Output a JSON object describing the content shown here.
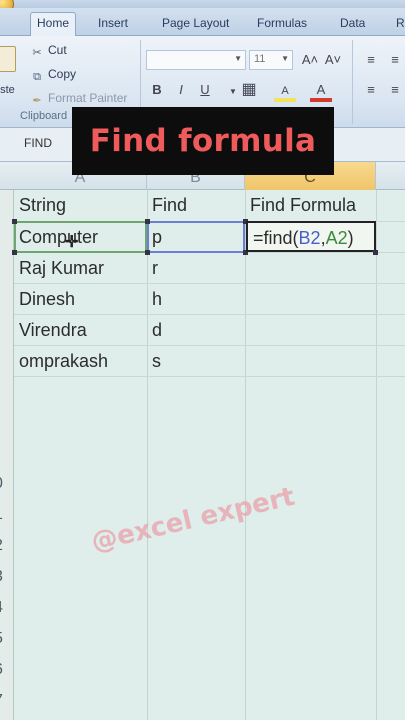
{
  "ribbon": {
    "tabs": [
      "Home",
      "Insert",
      "Page Layout",
      "Formulas",
      "Data",
      "R"
    ],
    "active_tab": "Home",
    "clipboard": {
      "paste_label": "aste",
      "cut_label": "Cut",
      "copy_label": "Copy",
      "format_painter_label": "Format Painter",
      "group_label": "Clipboard"
    },
    "font": {
      "size_value": "11",
      "grow_label": "A˄",
      "shrink_label": "A˅",
      "bold_label": "B",
      "italic_label": "I",
      "underline_label": "U",
      "fill_label": "A",
      "font_color_label": "A"
    }
  },
  "formula_bar": {
    "name_box": "FIND"
  },
  "grid": {
    "columns": [
      "A",
      "B",
      "C"
    ],
    "rows": [
      "0",
      "1",
      "2",
      "3",
      "4",
      "5",
      "6",
      "7"
    ],
    "header_row": {
      "a": "String",
      "b": "Find",
      "c": "Find Formula"
    },
    "data_rows": [
      {
        "a": "Computer",
        "b": "p"
      },
      {
        "a": "Raj Kumar",
        "b": "r"
      },
      {
        "a": "Dinesh",
        "b": "h"
      },
      {
        "a": "Virendra",
        "b": "d"
      },
      {
        "a": "omprakash",
        "b": "s"
      }
    ],
    "formula_cell": {
      "prefix": "=find(",
      "ref1": "B2",
      "comma": ",",
      "ref2": "A2",
      "suffix": ")"
    }
  },
  "overlay": {
    "banner": "Find formula",
    "watermark": "@excel expert"
  },
  "colors": {
    "banner_bg": "#0d0d0d",
    "banner_text": "#ef5b5b",
    "ref_b2": "#4a5fc6",
    "ref_a2": "#3a8a3a",
    "active_column": "#f0c56a"
  }
}
